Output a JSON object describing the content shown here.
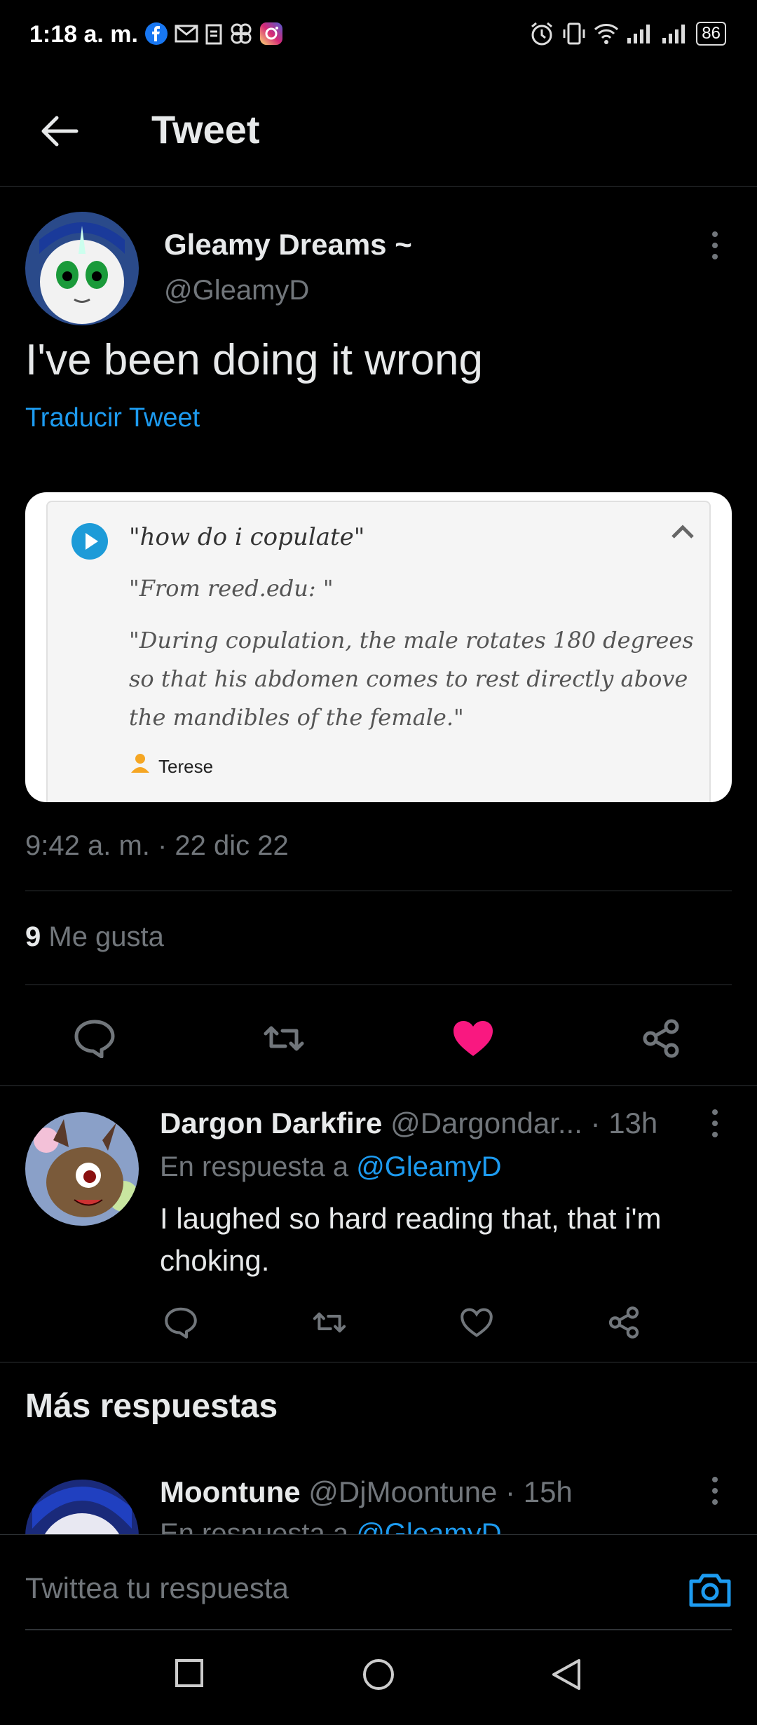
{
  "status_bar": {
    "time": "1:18 a. m.",
    "battery": "86",
    "left_icons": [
      "facebook-icon",
      "gmail-icon",
      "clipboard-icon",
      "pinwheel-icon",
      "instagram-icon"
    ],
    "right_icons": [
      "alarm-icon",
      "vibrate-icon",
      "wifi-icon",
      "signal-icon",
      "signal-icon"
    ]
  },
  "header": {
    "title": "Tweet"
  },
  "tweet": {
    "author_name": "Gleamy Dreams ~",
    "author_handle": "@GleamyD",
    "text": "I've been doing it wrong",
    "translate_label": "Traducir Tweet",
    "media": {
      "query": "\"how do i copulate\"",
      "source": "\"From reed.edu: \"",
      "quote": "\"During copulation, the male rotates 180 degrees so that his abdomen comes to rest directly above the mandibles of the female.\"",
      "user": "Terese"
    },
    "timestamp": "9:42 a. m. · 22 dic 22",
    "likes_count": "9",
    "likes_label": "Me gusta",
    "liked": true,
    "like_color": "#f91880"
  },
  "reply": {
    "name": "Dargon Darkfire",
    "handle_time": "@Dargondar... · 13h",
    "reply_prefix": "En respuesta a",
    "reply_to": "@GleamyD",
    "text": "I laughed so hard reading that, that i'm choking."
  },
  "more_replies": {
    "title": "Más respuestas",
    "next": {
      "name": "Moontune",
      "handle_time": "@DjMoontune · 15h",
      "reply_prefix": "En respuesta a",
      "reply_to": "@GleamyD"
    }
  },
  "compose": {
    "placeholder": "Twittea tu respuesta"
  },
  "colors": {
    "accent": "#1d9bf0",
    "background": "#000000",
    "secondary_text": "#71767b"
  }
}
